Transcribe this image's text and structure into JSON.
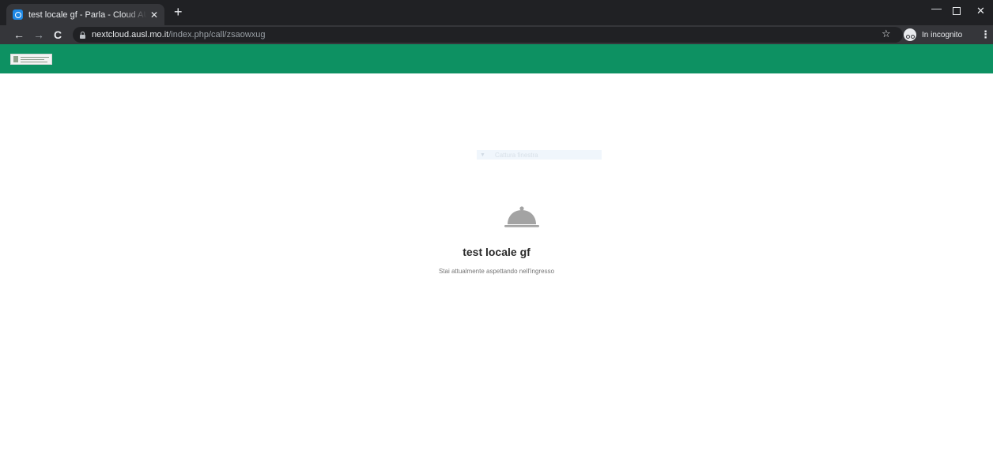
{
  "browser": {
    "tab": {
      "title": "test locale gf - Parla - Cloud AUSL"
    },
    "address": {
      "host": "nextcloud.ausl.mo.it",
      "path": "/index.php/call/zsaowxug"
    },
    "incognito_label": "In incognito",
    "icons": [
      "back-arrow-icon",
      "forward-arrow-icon",
      "reload-icon",
      "lock-icon",
      "star-icon",
      "incognito-icon",
      "more-menu-icon"
    ]
  },
  "ghost_overlay": {
    "text": "Cattura finestra"
  },
  "lobby": {
    "title": "test locale gf",
    "subtitle": "Stai attualmente aspettando nell'ingresso",
    "icon": "cloche-icon"
  },
  "colors": {
    "header": "#0d9162",
    "tabstrip": "#202124",
    "toolbar": "#35363a",
    "cloche": "#a3a3a3"
  }
}
